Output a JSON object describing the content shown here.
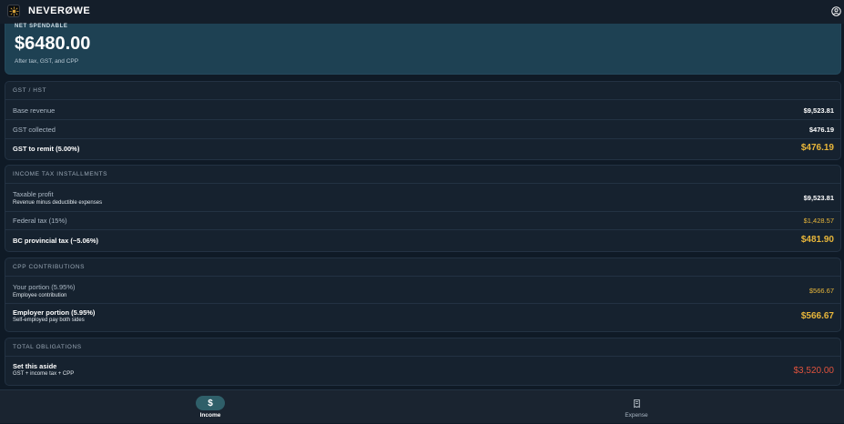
{
  "app": {
    "title": "NEVERØWE"
  },
  "hero": {
    "label": "NET SPENDABLE",
    "amount": "$6480.00",
    "subtitle": "After tax, GST, and CPP"
  },
  "gst": {
    "header": "GST / HST",
    "rows": [
      {
        "label": "Base revenue",
        "value": "$9,523.81"
      },
      {
        "label": "GST collected",
        "value": "$476.19"
      },
      {
        "label": "GST to remit (5.00%)",
        "value": "$476.19"
      }
    ]
  },
  "income_tax": {
    "header": "INCOME TAX INSTALLMENTS",
    "rows": [
      {
        "label": "Taxable profit",
        "sub": "Revenue minus deductible expenses",
        "value": "$9,523.81"
      },
      {
        "label": "Federal tax (15%)",
        "value": "$1,428.57"
      },
      {
        "label": "BC provincial tax (~5.06%)",
        "value": "$481.90"
      }
    ]
  },
  "cpp": {
    "header": "CPP CONTRIBUTIONS",
    "rows": [
      {
        "label": "Your portion (5.95%)",
        "sub": "Employee contribution",
        "value": "$566.67"
      },
      {
        "label": "Employer portion (5.95%)",
        "sub": "Self-employed pay both sides",
        "value": "$566.67"
      }
    ]
  },
  "totals": {
    "header": "TOTAL OBLIGATIONS",
    "label": "Set this aside",
    "sub": "GST + income tax + CPP",
    "value": "$3,520.00"
  },
  "nav": {
    "items": [
      {
        "label": "Income",
        "icon": "dollar-icon",
        "active": true
      },
      {
        "label": "Expense",
        "icon": "receipt-icon",
        "active": false
      }
    ]
  },
  "colors": {
    "accent": "#e8b63a",
    "danger": "#e0533d",
    "hero_bg": "#1e4153"
  }
}
